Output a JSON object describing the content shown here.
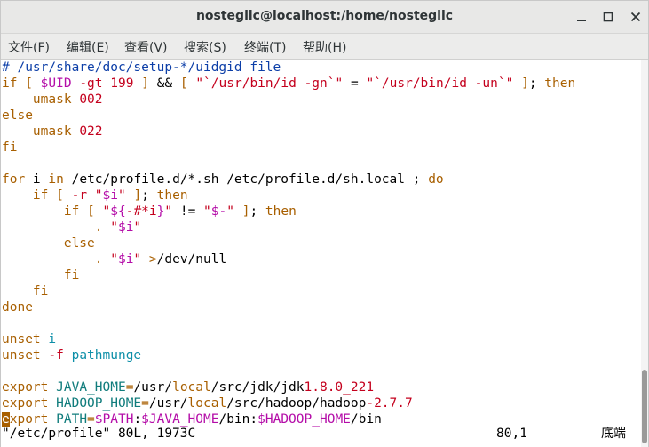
{
  "window": {
    "title": "nosteglic@localhost:/home/nosteglic",
    "minimize_icon": "minimize-icon",
    "maximize_icon": "maximize-icon",
    "close_icon": "close-icon"
  },
  "menubar": {
    "items": [
      {
        "label": "文件(F)"
      },
      {
        "label": "编辑(E)"
      },
      {
        "label": "查看(V)"
      },
      {
        "label": "搜索(S)"
      },
      {
        "label": "终端(T)"
      },
      {
        "label": "帮助(H)"
      }
    ]
  },
  "editor": {
    "lines": [
      [
        {
          "t": "# /usr/share/doc/setup-*/uidgid file",
          "c": "c-comment"
        }
      ],
      [
        {
          "t": "if",
          "c": "c-kw"
        },
        {
          "t": " "
        },
        {
          "t": "[",
          "c": "c-kw"
        },
        {
          "t": " "
        },
        {
          "t": "$UID",
          "c": "c-var"
        },
        {
          "t": " "
        },
        {
          "t": "-gt",
          "c": "c-op"
        },
        {
          "t": " "
        },
        {
          "t": "199",
          "c": "c-num"
        },
        {
          "t": " "
        },
        {
          "t": "]",
          "c": "c-kw"
        },
        {
          "t": " && "
        },
        {
          "t": "[",
          "c": "c-kw"
        },
        {
          "t": " "
        },
        {
          "t": "\"`",
          "c": "c-str"
        },
        {
          "t": "/usr/bin/id",
          "c": "c-str"
        },
        {
          "t": " "
        },
        {
          "t": "-gn",
          "c": "c-op"
        },
        {
          "t": "`\"",
          "c": "c-str"
        },
        {
          "t": " = "
        },
        {
          "t": "\"`",
          "c": "c-str"
        },
        {
          "t": "/usr/bin/id",
          "c": "c-str"
        },
        {
          "t": " "
        },
        {
          "t": "-un",
          "c": "c-op"
        },
        {
          "t": "`\"",
          "c": "c-str"
        },
        {
          "t": " "
        },
        {
          "t": "]",
          "c": "c-kw"
        },
        {
          "t": "; "
        },
        {
          "t": "then",
          "c": "c-kw"
        }
      ],
      [
        {
          "t": "    "
        },
        {
          "t": "umask",
          "c": "c-kw"
        },
        {
          "t": " "
        },
        {
          "t": "002",
          "c": "c-num"
        }
      ],
      [
        {
          "t": "else",
          "c": "c-kw"
        }
      ],
      [
        {
          "t": "    "
        },
        {
          "t": "umask",
          "c": "c-kw"
        },
        {
          "t": " "
        },
        {
          "t": "022",
          "c": "c-num"
        }
      ],
      [
        {
          "t": "fi",
          "c": "c-kw"
        }
      ],
      [
        {
          "t": ""
        }
      ],
      [
        {
          "t": "for",
          "c": "c-kw"
        },
        {
          "t": " i "
        },
        {
          "t": "in",
          "c": "c-kw"
        },
        {
          "t": " /etc/profile.d/*.sh /etc/profile.d/sh.local ; "
        },
        {
          "t": "do",
          "c": "c-kw"
        }
      ],
      [
        {
          "t": "    "
        },
        {
          "t": "if",
          "c": "c-kw"
        },
        {
          "t": " "
        },
        {
          "t": "[",
          "c": "c-kw"
        },
        {
          "t": " "
        },
        {
          "t": "-r",
          "c": "c-op"
        },
        {
          "t": " "
        },
        {
          "t": "\"",
          "c": "c-str"
        },
        {
          "t": "$i",
          "c": "c-var"
        },
        {
          "t": "\"",
          "c": "c-str"
        },
        {
          "t": " "
        },
        {
          "t": "]",
          "c": "c-kw"
        },
        {
          "t": "; "
        },
        {
          "t": "then",
          "c": "c-kw"
        }
      ],
      [
        {
          "t": "        "
        },
        {
          "t": "if",
          "c": "c-kw"
        },
        {
          "t": " "
        },
        {
          "t": "[",
          "c": "c-kw"
        },
        {
          "t": " "
        },
        {
          "t": "\"",
          "c": "c-str"
        },
        {
          "t": "${",
          "c": "c-var"
        },
        {
          "t": "-#*i",
          "c": "c-op"
        },
        {
          "t": "}",
          "c": "c-var"
        },
        {
          "t": "\"",
          "c": "c-str"
        },
        {
          "t": " != "
        },
        {
          "t": "\"",
          "c": "c-str"
        },
        {
          "t": "$-",
          "c": "c-var"
        },
        {
          "t": "\"",
          "c": "c-str"
        },
        {
          "t": " "
        },
        {
          "t": "]",
          "c": "c-kw"
        },
        {
          "t": "; "
        },
        {
          "t": "then",
          "c": "c-kw"
        }
      ],
      [
        {
          "t": "            "
        },
        {
          "t": ".",
          "c": "c-kw"
        },
        {
          "t": " "
        },
        {
          "t": "\"",
          "c": "c-str"
        },
        {
          "t": "$i",
          "c": "c-var"
        },
        {
          "t": "\"",
          "c": "c-str"
        }
      ],
      [
        {
          "t": "        "
        },
        {
          "t": "else",
          "c": "c-kw"
        }
      ],
      [
        {
          "t": "            "
        },
        {
          "t": ".",
          "c": "c-kw"
        },
        {
          "t": " "
        },
        {
          "t": "\"",
          "c": "c-str"
        },
        {
          "t": "$i",
          "c": "c-var"
        },
        {
          "t": "\"",
          "c": "c-str"
        },
        {
          "t": " "
        },
        {
          "t": ">",
          "c": "c-kw"
        },
        {
          "t": "/dev/null"
        }
      ],
      [
        {
          "t": "        "
        },
        {
          "t": "fi",
          "c": "c-kw"
        }
      ],
      [
        {
          "t": "    "
        },
        {
          "t": "fi",
          "c": "c-kw"
        }
      ],
      [
        {
          "t": "done",
          "c": "c-kw"
        }
      ],
      [
        {
          "t": ""
        }
      ],
      [
        {
          "t": "unset",
          "c": "c-kw"
        },
        {
          "t": " "
        },
        {
          "t": "i",
          "c": "c-cyan"
        }
      ],
      [
        {
          "t": "unset",
          "c": "c-kw"
        },
        {
          "t": " "
        },
        {
          "t": "-f",
          "c": "c-op"
        },
        {
          "t": " "
        },
        {
          "t": "pathmunge",
          "c": "c-cyan"
        }
      ],
      [
        {
          "t": ""
        }
      ],
      [
        {
          "t": "export",
          "c": "c-kw"
        },
        {
          "t": " "
        },
        {
          "t": "JAVA_HOME",
          "c": "c-teal"
        },
        {
          "t": "=",
          "c": "c-kw"
        },
        {
          "t": "/usr/"
        },
        {
          "t": "local",
          "c": "c-local"
        },
        {
          "t": "/src/jdk/jdk"
        },
        {
          "t": "1.8.0_221",
          "c": "c-num"
        }
      ],
      [
        {
          "t": "export",
          "c": "c-kw"
        },
        {
          "t": " "
        },
        {
          "t": "HADOOP_HOME",
          "c": "c-teal"
        },
        {
          "t": "=",
          "c": "c-kw"
        },
        {
          "t": "/usr/"
        },
        {
          "t": "local",
          "c": "c-local"
        },
        {
          "t": "/src/hadoop/hadoop"
        },
        {
          "t": "-2.7.7",
          "c": "c-num"
        }
      ],
      [
        {
          "t": "e",
          "c": "cursor"
        },
        {
          "t": "xport",
          "c": "c-kw"
        },
        {
          "t": " "
        },
        {
          "t": "PATH",
          "c": "c-teal"
        },
        {
          "t": "=",
          "c": "c-kw"
        },
        {
          "t": "$PATH",
          "c": "c-var"
        },
        {
          "t": ":"
        },
        {
          "t": "$JAVA_HOME",
          "c": "c-var"
        },
        {
          "t": "/bin:"
        },
        {
          "t": "$HADOOP_HOME",
          "c": "c-var"
        },
        {
          "t": "/bin"
        }
      ]
    ]
  },
  "statusbar": {
    "file_info": "\"/etc/profile\" 80L, 1973C",
    "cursor_pos": "80,1",
    "scroll_pos": "底端"
  },
  "scrollbar": {
    "thumb_start_fraction": 0.8,
    "thumb_end_fraction": 1.0
  }
}
